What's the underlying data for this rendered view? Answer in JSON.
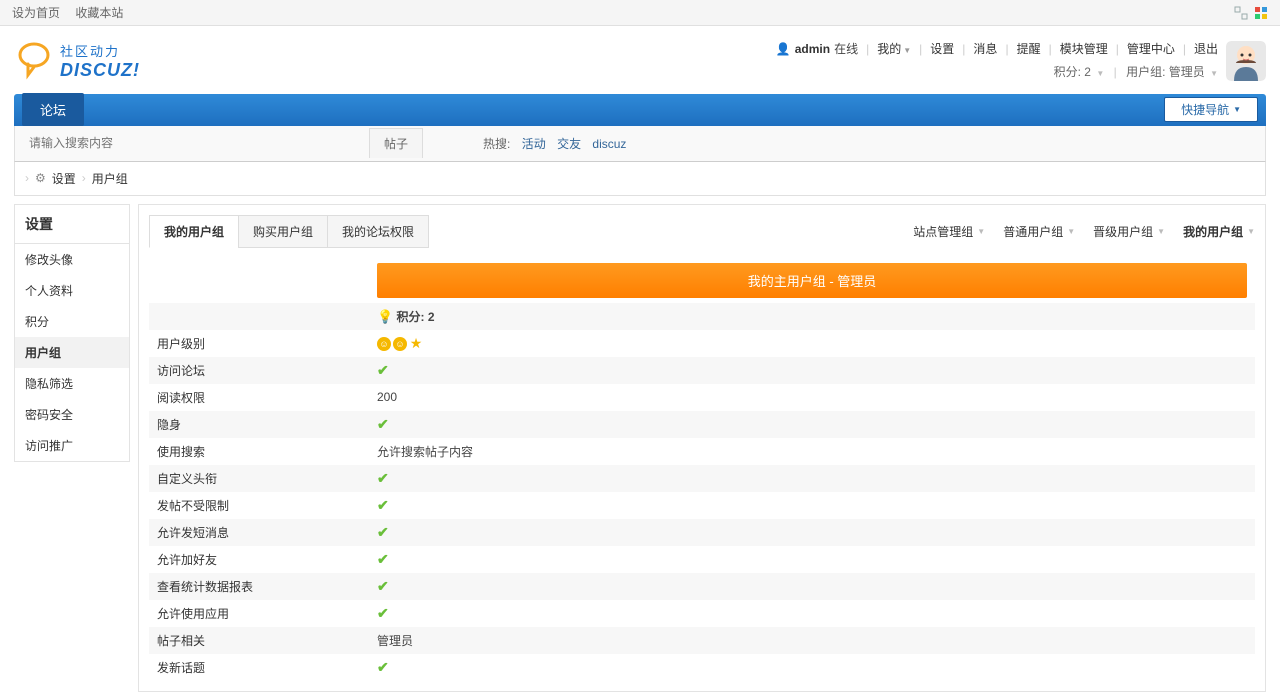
{
  "top_strip": {
    "home": "设为首页",
    "fav": "收藏本站"
  },
  "logo": {
    "cn": "社区动力",
    "en": "DISCUZ!"
  },
  "userbar": {
    "admin": "admin",
    "online": "在线",
    "mine": "我的",
    "settings": "设置",
    "msg": "消息",
    "remind": "提醒",
    "mod": "模块管理",
    "cp": "管理中心",
    "logout": "退出",
    "points_label": "积分: 2",
    "group_label": "用户组: 管理员"
  },
  "nav": {
    "forum": "论坛",
    "quick": "快捷导航"
  },
  "search": {
    "placeholder": "请输入搜索内容",
    "tab": "帖子",
    "hot_label": "热搜:",
    "hot1": "活动",
    "hot2": "交友",
    "hot3": "discuz"
  },
  "crumb": {
    "c1": "设置",
    "c2": "用户组"
  },
  "side": {
    "title": "设置",
    "items": [
      "修改头像",
      "个人资料",
      "积分",
      "用户组",
      "隐私筛选",
      "密码安全",
      "访问推广"
    ],
    "active_index": 3
  },
  "tabs_left": [
    "我的用户组",
    "购买用户组",
    "我的论坛权限"
  ],
  "tabs_left_active": 0,
  "tabs_right": [
    {
      "label": "站点管理组",
      "active": false
    },
    {
      "label": "普通用户组",
      "active": false
    },
    {
      "label": "晋级用户组",
      "active": false
    },
    {
      "label": "我的用户组",
      "active": true
    }
  ],
  "banner": "我的主用户组 - 管理员",
  "points_row": "积分: 2",
  "rows": [
    {
      "label": "用户级别",
      "type": "medal"
    },
    {
      "label": "访问论坛",
      "type": "check"
    },
    {
      "label": "阅读权限",
      "type": "text",
      "value": "200"
    },
    {
      "label": "隐身",
      "type": "check"
    },
    {
      "label": "使用搜索",
      "type": "text",
      "value": "允许搜索帖子内容"
    },
    {
      "label": "自定义头衔",
      "type": "check"
    },
    {
      "label": "发帖不受限制",
      "type": "check"
    },
    {
      "label": "允许发短消息",
      "type": "check"
    },
    {
      "label": "允许加好友",
      "type": "check"
    },
    {
      "label": "查看统计数据报表",
      "type": "check"
    },
    {
      "label": "允许使用应用",
      "type": "check"
    },
    {
      "label": "帖子相关",
      "type": "text",
      "value": "管理员"
    },
    {
      "label": "发新话题",
      "type": "check"
    }
  ]
}
